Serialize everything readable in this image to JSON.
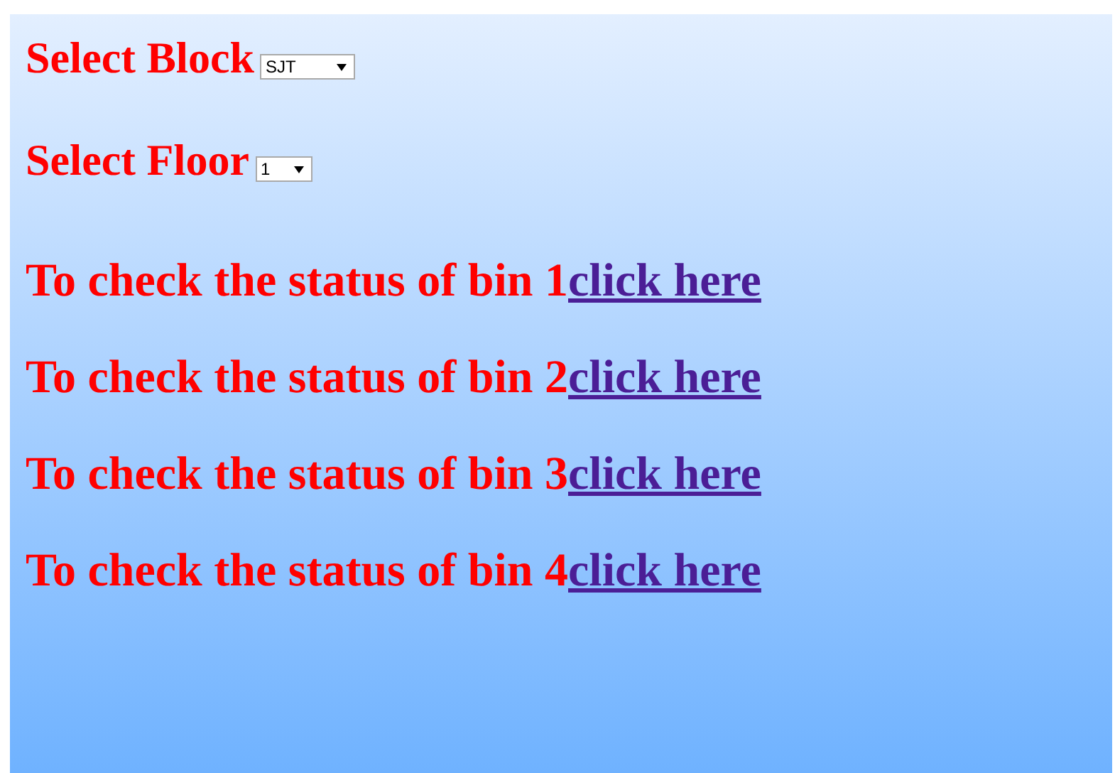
{
  "selects": [
    {
      "label": "Select Block",
      "value": "SJT"
    },
    {
      "label": "Select Floor",
      "value": "1"
    }
  ],
  "bins": [
    {
      "text": "To check the status of bin 1",
      "link": "click here"
    },
    {
      "text": "To check the status of bin 2",
      "link": "click here"
    },
    {
      "text": "To check the status of bin 3",
      "link": "click here"
    },
    {
      "text": "To check the status of bin 4",
      "link": "click here"
    }
  ]
}
